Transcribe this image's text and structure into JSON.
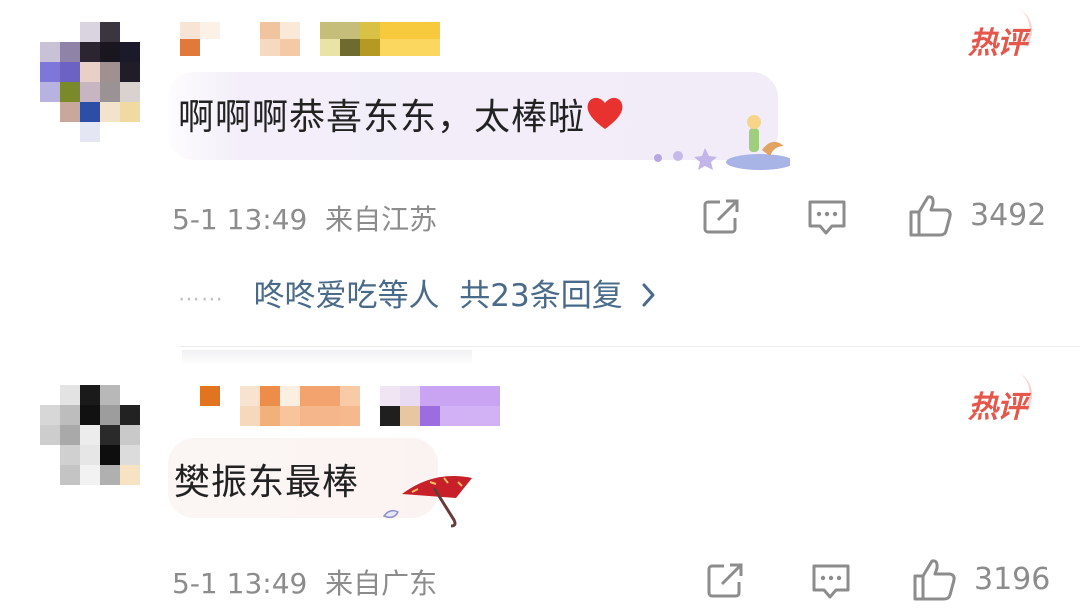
{
  "comments": [
    {
      "badge": "热评",
      "text": "啊啊啊恭喜东东，太棒啦",
      "time": "5-1 13:49",
      "location": "来自江苏",
      "likes": "3492",
      "replies": {
        "names": "咚咚爱吃",
        "names_suffix": "等人",
        "count_text": "共23条回复"
      }
    },
    {
      "badge": "热评",
      "text": "樊振东最棒",
      "time": "5-1 13:49",
      "location": "来自广东",
      "likes": "3196"
    }
  ],
  "icons": [
    "share-icon",
    "comment-icon",
    "like-icon",
    "heart-emoji",
    "chevron-right-icon"
  ],
  "colors": {
    "badge": "#e5574a",
    "link": "#4a6a8a",
    "meta": "#8c8c8c",
    "bubble": "#f1ecf8"
  }
}
